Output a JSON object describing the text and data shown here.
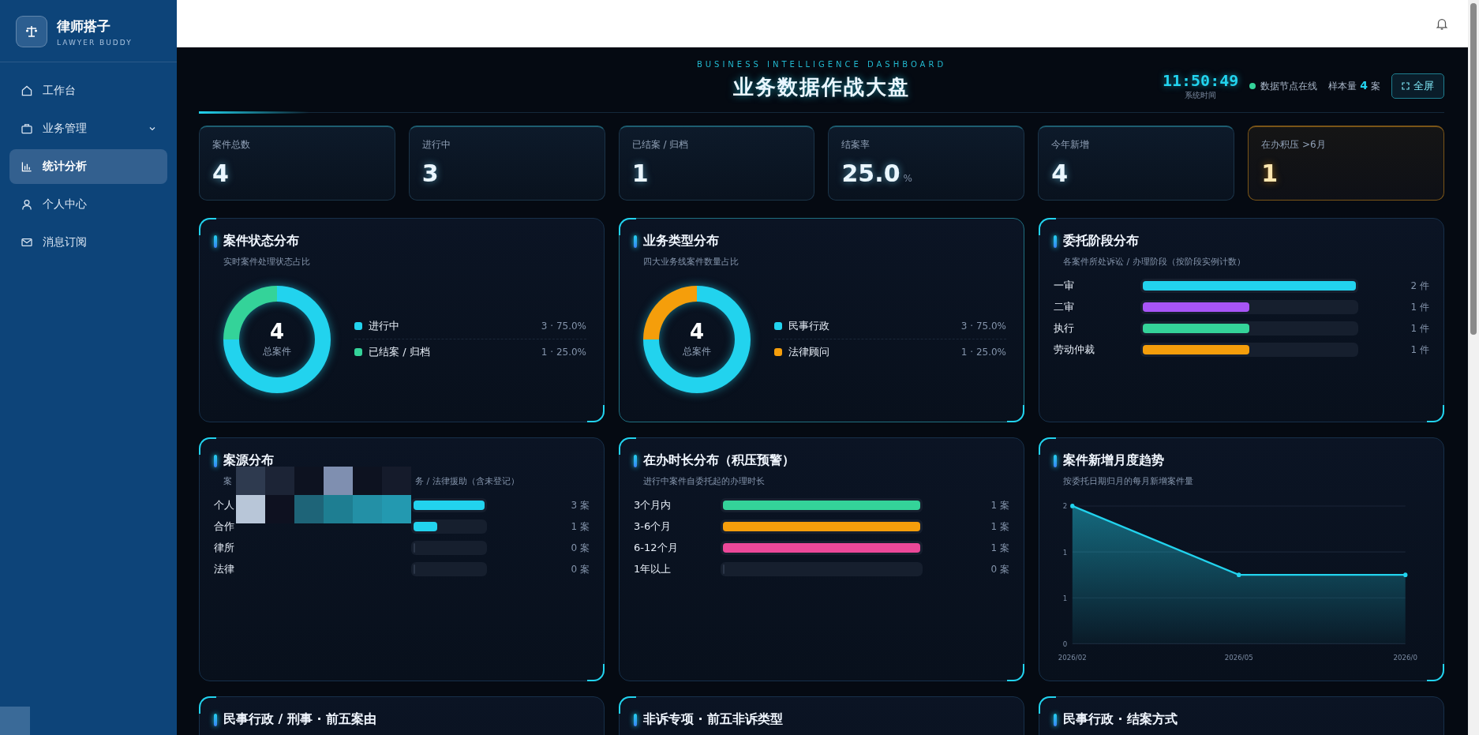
{
  "sidebar": {
    "brand": "律师搭子",
    "brand_sub": "LAWYER BUDDY",
    "items": [
      {
        "label": "工作台",
        "selected": false,
        "expandable": false
      },
      {
        "label": "业务管理",
        "selected": false,
        "expandable": true
      },
      {
        "label": "统计分析",
        "selected": true,
        "expandable": false
      },
      {
        "label": "个人中心",
        "selected": false,
        "expandable": false
      },
      {
        "label": "消息订阅",
        "selected": false,
        "expandable": false
      }
    ]
  },
  "dashboard": {
    "eyebrow": "BUSINESS INTELLIGENCE DASHBOARD",
    "title": "业务数据作战大盘",
    "clock": "11:50:49",
    "clock_label": "系统时间",
    "status": "数据节点在线",
    "sample_label": "样本量",
    "sample_value": "4",
    "sample_unit": "案",
    "fullscreen": "全屏"
  },
  "kpis": [
    {
      "label": "案件总数",
      "value": "4",
      "warning": false
    },
    {
      "label": "进行中",
      "value": "3",
      "warning": false
    },
    {
      "label": "已结案 / 归档",
      "value": "1",
      "warning": false
    },
    {
      "label": "结案率",
      "value": "25.0",
      "unit": "%",
      "warning": false
    },
    {
      "label": "今年新增",
      "value": "4",
      "warning": false
    },
    {
      "label": "在办积压 >6月",
      "value": "1",
      "warning": true
    }
  ],
  "panels": [
    {
      "kind": "donut",
      "title": "案件状态分布",
      "subtitle": "实时案件处理状态占比",
      "total": "4",
      "total_label": "总案件",
      "highlighted": false,
      "legend": [
        {
          "reading": "3 · 75.0%",
          "color": "#22d3ee"
        },
        {
          "reading": "1 · 25.0%",
          "color": "#34d399"
        }
      ],
      "chart_data": {
        "type": "donut",
        "categories": [
          "进行中",
          "已结案 / 归档"
        ],
        "values": [
          75,
          25
        ]
      }
    },
    {
      "kind": "donut",
      "title": "业务类型分布",
      "subtitle": "四大业务线案件数量占比",
      "total": "4",
      "total_label": "总案件",
      "highlighted": true,
      "legend": [
        {
          "reading": "3 · 75.0%",
          "color": "#22d3ee"
        },
        {
          "reading": "1 · 25.0%",
          "color": "#f59e0b"
        }
      ],
      "chart_data": {
        "type": "donut",
        "categories": [
          "民事行政",
          "法律顾问"
        ],
        "values": [
          75,
          25
        ]
      }
    },
    {
      "kind": "bars",
      "title": "委托阶段分布",
      "subtitle": "各案件所处诉讼 / 办理阶段（按阶段实例计数）",
      "redacted": false,
      "rows": [
        {
          "label": "一审",
          "reading": "2 件",
          "level": 1,
          "color": "#22d3ee"
        },
        {
          "label": "二审",
          "reading": "1 件",
          "level": 0.5,
          "color": "#a855f7"
        },
        {
          "label": "执行",
          "reading": "1 件",
          "level": 0.5,
          "color": "#34d399"
        },
        {
          "label": "劳动仲裁",
          "reading": "1 件",
          "level": 0.5,
          "color": "#f59e0b"
        }
      ]
    },
    {
      "kind": "bars",
      "title": "案源分布",
      "subtitle": "案",
      "subtitle_end": "务 / 法律援助（含未登记）",
      "redacted": true,
      "rows": [
        {
          "label": "个人",
          "reading": "3 案",
          "level": 1,
          "color": "#22d3ee"
        },
        {
          "label": "合作",
          "reading": "1 案",
          "level": 0.33,
          "color": "#22d3ee"
        },
        {
          "label": "律所",
          "reading": "0 案",
          "level": 0
        },
        {
          "label": "法律",
          "reading": "0 案",
          "level": 0
        }
      ]
    },
    {
      "kind": "bars",
      "title": "在办时长分布（积压预警）",
      "subtitle": "进行中案件自委托起的办理时长",
      "redacted": false,
      "rows": [
        {
          "label": "3个月内",
          "reading": "1 案",
          "level": 1,
          "color": "#34d399"
        },
        {
          "label": "3-6个月",
          "reading": "1 案",
          "level": 1,
          "color": "#f59e0b"
        },
        {
          "label": "6-12个月",
          "reading": "1 案",
          "level": 1,
          "color": "#ec4899"
        },
        {
          "label": "1年以上",
          "reading": "0 案",
          "level": 0
        }
      ]
    },
    {
      "kind": "line",
      "title": "案件新增月度趋势",
      "subtitle": "按委托日期归月的每月新增案件量",
      "chart_data": {
        "type": "area",
        "categories": [
          "2026/02",
          "2026/05",
          "2026/0"
        ],
        "series": [
          {
            "color": "#22d3ee",
            "values": [
              2,
              1,
              1
            ]
          }
        ],
        "ylim": [
          0,
          2
        ],
        "yticks": [
          {
            "value": 0,
            "label": "0"
          },
          {
            "value": 0.667,
            "label": "1"
          },
          {
            "value": 1.333,
            "label": "1"
          },
          {
            "value": 2,
            "label": "2"
          }
        ]
      }
    },
    {
      "kind": "stub",
      "title": "民事行政 / 刑事 · 前五案由"
    },
    {
      "kind": "stub",
      "title": "非诉专项 · 前五非诉类型"
    },
    {
      "kind": "stub",
      "title": "民事行政 · 结案方式"
    }
  ]
}
